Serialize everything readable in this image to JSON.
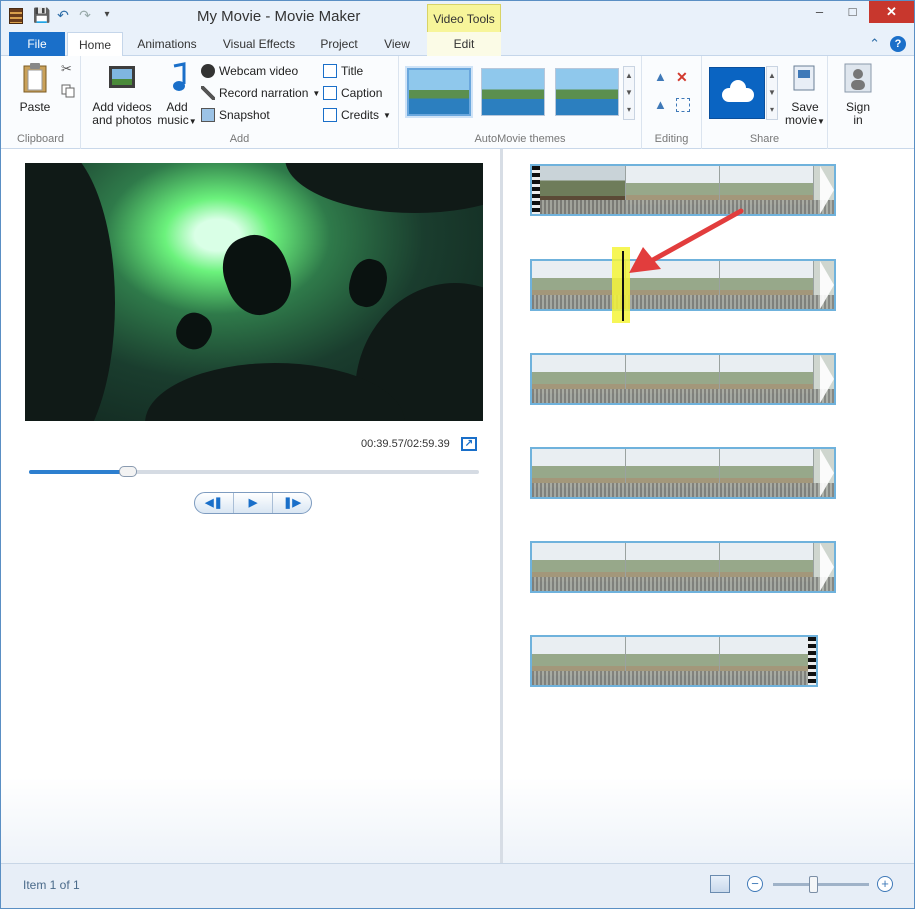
{
  "window": {
    "title": "My Movie - Movie Maker",
    "context_tab_header": "Video Tools"
  },
  "tabs": [
    {
      "label": "File"
    },
    {
      "label": "Home"
    },
    {
      "label": "Animations"
    },
    {
      "label": "Visual Effects"
    },
    {
      "label": "Project"
    },
    {
      "label": "View"
    },
    {
      "label": "Edit"
    }
  ],
  "ribbon": {
    "clipboard": {
      "label": "Clipboard",
      "paste": "Paste"
    },
    "add": {
      "label": "Add",
      "add_videos_line1": "Add videos",
      "add_videos_line2": "and photos",
      "add_music_line1": "Add",
      "add_music_line2": "music",
      "webcam": "Webcam video",
      "narration": "Record narration",
      "snapshot": "Snapshot",
      "title": "Title",
      "caption": "Caption",
      "credits": "Credits"
    },
    "themes": {
      "label": "AutoMovie themes"
    },
    "editing": {
      "label": "Editing"
    },
    "share": {
      "label": "Share",
      "save_line1": "Save",
      "save_line2": "movie",
      "sign_line1": "Sign",
      "sign_line2": "in"
    }
  },
  "player": {
    "time": "00:39.57/02:59.39",
    "progress": 0.22
  },
  "status": {
    "text": "Item 1 of 1",
    "zoom_level": 0.42
  },
  "colors": {
    "accent": "#1a6fc9",
    "clip_border": "#6fb2dc",
    "highlight": "#f5f43a",
    "annotation_arrow": "#e23d3d"
  }
}
